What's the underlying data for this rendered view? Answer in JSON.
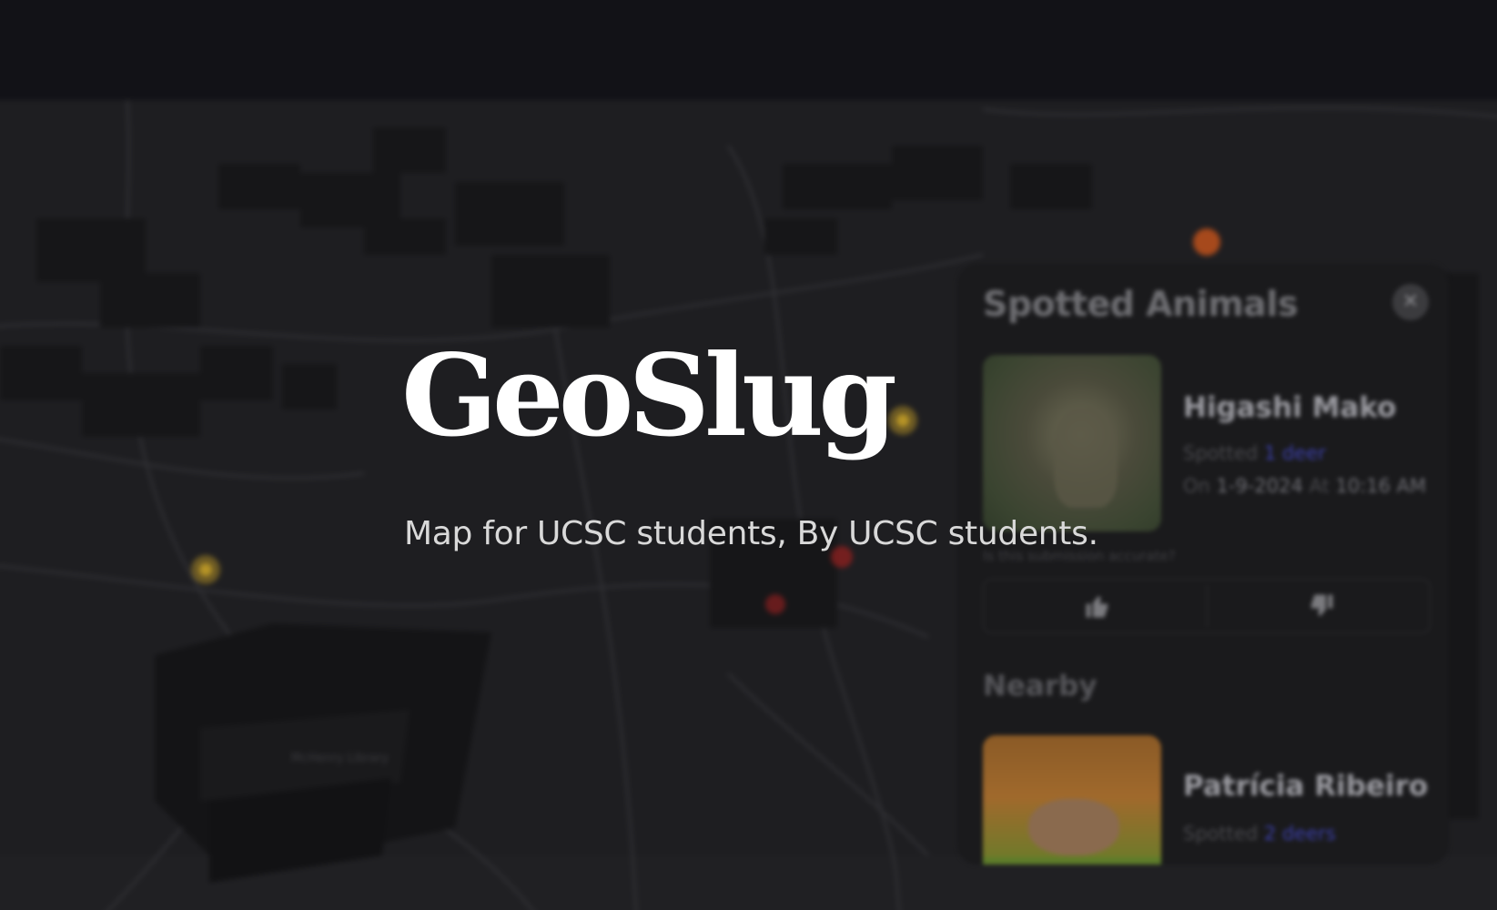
{
  "hero": {
    "title": "GeoSlug",
    "subtitle": "Map for UCSC students, By UCSC students."
  },
  "panel": {
    "title": "Spotted Animals",
    "close_icon": "close-icon",
    "accuracy_prompt": "Is this submission accurate?",
    "upvote_icon": "thumbs-up-icon",
    "downvote_icon": "thumbs-down-icon",
    "nearby_label": "Nearby",
    "sightings": [
      {
        "name": "Higashi Mako",
        "spotted_label": "Spotted",
        "spotted_value": "1 deer",
        "on_label": "On",
        "date": "1-9-2024",
        "at_label": "At",
        "time": "10:16 AM"
      },
      {
        "name": "Patrícia Ribeiro",
        "spotted_label": "Spotted",
        "spotted_value": "2 deers"
      }
    ]
  },
  "map": {
    "labels": [
      "McHenry Library"
    ]
  },
  "colors": {
    "background": "#1c1c1e",
    "hero_title": "#ffffff",
    "hero_subtitle": "#d9d9d9",
    "link_accent": "#3b3fa8",
    "marker_yellow": "#c9a227",
    "marker_red": "#8a1f1f",
    "marker_orange": "#c8541c"
  }
}
